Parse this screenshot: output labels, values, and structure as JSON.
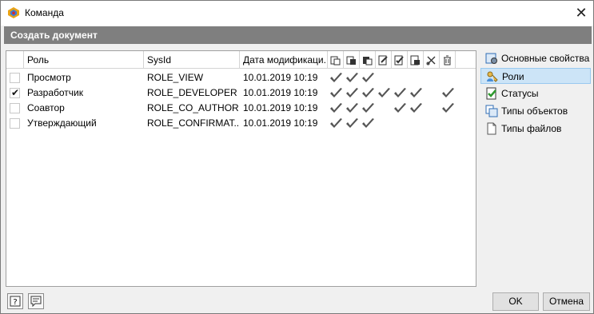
{
  "window": {
    "title": "Команда",
    "close_label": "✕"
  },
  "header": {
    "title": "Создать документ"
  },
  "grid": {
    "columns": {
      "role": "Роль",
      "sysid": "SysId",
      "date": "Дата модификаци..."
    },
    "rows": [
      {
        "checked": false,
        "role": "Просмотр",
        "sysid": "ROLE_VIEW",
        "date": "10.01.2019 10:19",
        "perms": [
          1,
          1,
          1,
          0,
          0,
          0,
          0,
          0
        ]
      },
      {
        "checked": true,
        "role": "Разработчик",
        "sysid": "ROLE_DEVELOPER",
        "date": "10.01.2019 10:19",
        "perms": [
          1,
          1,
          1,
          1,
          1,
          1,
          0,
          1
        ]
      },
      {
        "checked": false,
        "role": "Соавтор",
        "sysid": "ROLE_CO_AUTHOR",
        "date": "10.01.2019 10:19",
        "perms": [
          1,
          1,
          1,
          0,
          1,
          1,
          0,
          1
        ]
      },
      {
        "checked": false,
        "role": "Утверждающий",
        "sysid": "ROLE_CONFIRMAT...",
        "date": "10.01.2019 10:19",
        "perms": [
          1,
          1,
          1,
          0,
          0,
          0,
          0,
          0
        ]
      }
    ]
  },
  "sidebar": {
    "items": [
      {
        "label": "Основные свойства",
        "icon": "properties-icon"
      },
      {
        "label": "Роли",
        "icon": "roles-icon",
        "active": true
      },
      {
        "label": "Статусы",
        "icon": "statuses-icon"
      },
      {
        "label": "Типы объектов",
        "icon": "object-types-icon"
      },
      {
        "label": "Типы файлов",
        "icon": "file-types-icon"
      }
    ]
  },
  "footer": {
    "ok_label": "OK",
    "cancel_label": "Отмена"
  },
  "colors": {
    "header_bar": "#7f7f7f",
    "selection": "#cce4f7"
  }
}
